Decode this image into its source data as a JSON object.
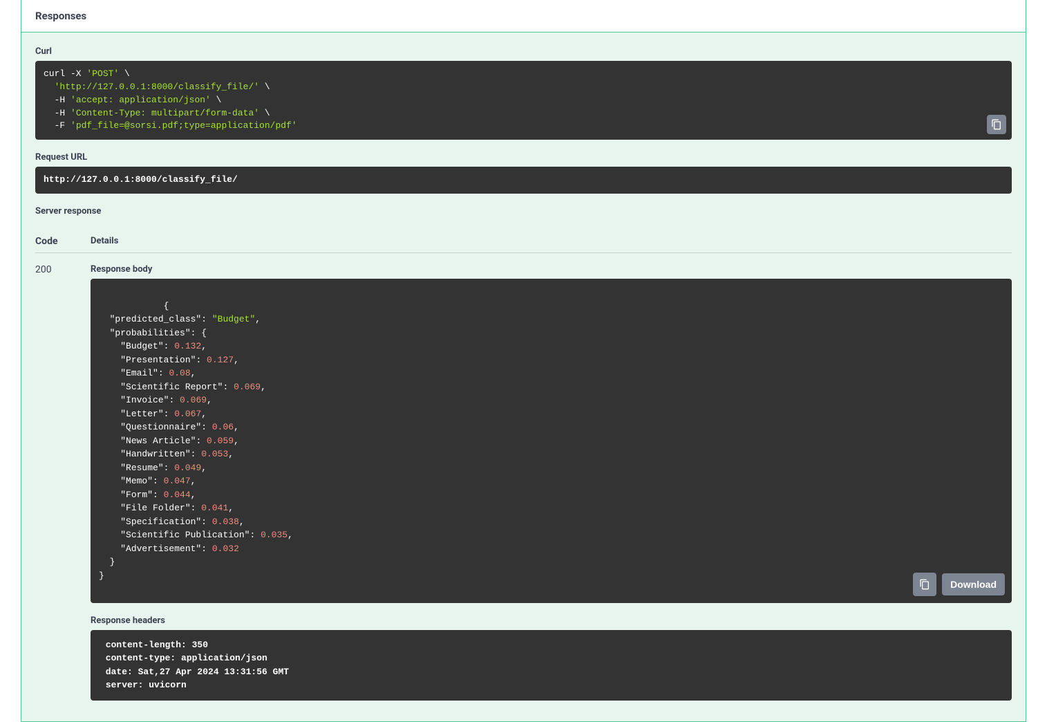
{
  "header": {
    "title": "Responses"
  },
  "curl": {
    "label": "Curl",
    "cmd": "curl -X ",
    "method": "'POST'",
    "bs": " \\",
    "url": "'http://127.0.0.1:8000/classify_file/'",
    "h1_flag": "  -H ",
    "h1": "'accept: application/json'",
    "h2_flag": "  -H ",
    "h2": "'Content-Type: multipart/form-data'",
    "f_flag": "  -F ",
    "f": "'pdf_file=@sorsi.pdf;type=application/pdf'"
  },
  "request_url": {
    "label": "Request URL",
    "value": "http://127.0.0.1:8000/classify_file/"
  },
  "server_response": {
    "label": "Server response"
  },
  "columns": {
    "code": "Code",
    "details": "Details"
  },
  "row": {
    "code": "200"
  },
  "response_body": {
    "label": "Response body",
    "open": "{",
    "pc_key": "\"predicted_class\"",
    "pc_val": "\"Budget\"",
    "prob_key": "\"probabilities\"",
    "items": [
      {
        "k": "\"Budget\"",
        "v": "0.132"
      },
      {
        "k": "\"Presentation\"",
        "v": "0.127"
      },
      {
        "k": "\"Email\"",
        "v": "0.08"
      },
      {
        "k": "\"Scientific Report\"",
        "v": "0.069"
      },
      {
        "k": "\"Invoice\"",
        "v": "0.069"
      },
      {
        "k": "\"Letter\"",
        "v": "0.067"
      },
      {
        "k": "\"Questionnaire\"",
        "v": "0.06"
      },
      {
        "k": "\"News Article\"",
        "v": "0.059"
      },
      {
        "k": "\"Handwritten\"",
        "v": "0.053"
      },
      {
        "k": "\"Resume\"",
        "v": "0.049"
      },
      {
        "k": "\"Memo\"",
        "v": "0.047"
      },
      {
        "k": "\"Form\"",
        "v": "0.044"
      },
      {
        "k": "\"File Folder\"",
        "v": "0.041"
      },
      {
        "k": "\"Specification\"",
        "v": "0.038"
      },
      {
        "k": "\"Scientific Publication\"",
        "v": "0.035"
      },
      {
        "k": "\"Advertisement\"",
        "v": "0.032"
      }
    ],
    "close_inner": "  }",
    "close": "}",
    "download": "Download"
  },
  "response_headers": {
    "label": "Response headers",
    "lines": " content-length: 350 \n content-type: application/json \n date: Sat,27 Apr 2024 13:31:56 GMT \n server: uvicorn "
  }
}
